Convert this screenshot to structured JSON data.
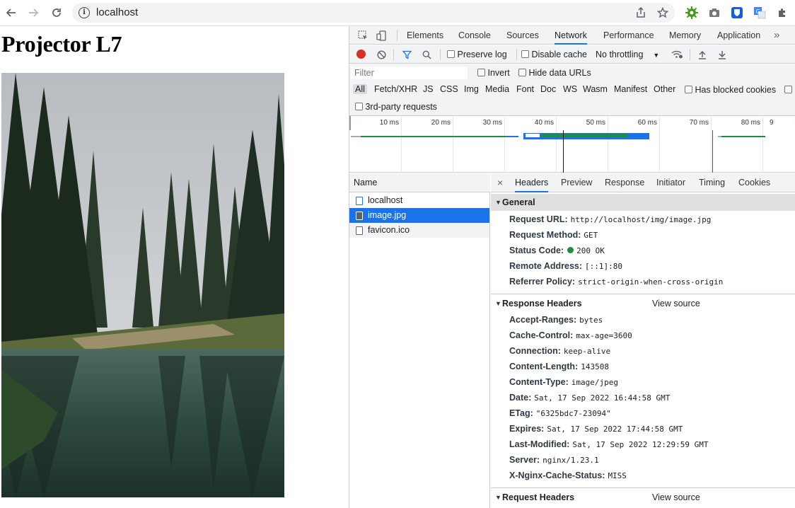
{
  "browser": {
    "url": "localhost"
  },
  "page": {
    "title": "Projector L7"
  },
  "devtools": {
    "tabs": [
      "Elements",
      "Console",
      "Sources",
      "Network",
      "Performance",
      "Memory",
      "Application"
    ],
    "active_tab": "Network",
    "more_tabs": "»",
    "toolbar": {
      "preserve_log": "Preserve log",
      "disable_cache": "Disable cache",
      "throttling": "No throttling"
    },
    "filter": {
      "placeholder": "Filter",
      "invert": "Invert",
      "hide_data_urls": "Hide data URLs"
    },
    "types": [
      "All",
      "Fetch/XHR",
      "JS",
      "CSS",
      "Img",
      "Media",
      "Font",
      "Doc",
      "WS",
      "Wasm",
      "Manifest",
      "Other"
    ],
    "has_blocked_cookies": "Has blocked cookies",
    "third_party": "3rd-party requests",
    "timeline_ticks": [
      "10 ms",
      "20 ms",
      "30 ms",
      "40 ms",
      "50 ms",
      "60 ms",
      "70 ms",
      "80 ms",
      "9"
    ],
    "name_header": "Name",
    "requests": [
      {
        "name": "localhost",
        "type": "doc"
      },
      {
        "name": "image.jpg",
        "type": "img",
        "selected": true
      },
      {
        "name": "favicon.ico",
        "type": "other"
      }
    ],
    "detail_tabs": [
      "Headers",
      "Preview",
      "Response",
      "Initiator",
      "Timing",
      "Cookies"
    ],
    "general": {
      "title": "General",
      "rows": [
        {
          "key": "Request URL:",
          "value": "http://localhost/img/image.jpg"
        },
        {
          "key": "Request Method:",
          "value": "GET"
        },
        {
          "key": "Status Code:",
          "value": "200 OK"
        },
        {
          "key": "Remote Address:",
          "value": "[::1]:80"
        },
        {
          "key": "Referrer Policy:",
          "value": "strict-origin-when-cross-origin"
        }
      ]
    },
    "response_headers": {
      "title": "Response Headers",
      "view_source": "View source",
      "rows": [
        {
          "key": "Accept-Ranges:",
          "value": "bytes"
        },
        {
          "key": "Cache-Control:",
          "value": "max-age=3600"
        },
        {
          "key": "Connection:",
          "value": "keep-alive"
        },
        {
          "key": "Content-Length:",
          "value": "143508"
        },
        {
          "key": "Content-Type:",
          "value": "image/jpeg"
        },
        {
          "key": "Date:",
          "value": "Sat, 17 Sep 2022 16:44:58 GMT"
        },
        {
          "key": "ETag:",
          "value": "\"6325bdc7-23094\""
        },
        {
          "key": "Expires:",
          "value": "Sat, 17 Sep 2022 17:44:58 GMT"
        },
        {
          "key": "Last-Modified:",
          "value": "Sat, 17 Sep 2022 12:29:59 GMT"
        },
        {
          "key": "Server:",
          "value": "nginx/1.23.1"
        },
        {
          "key": "X-Nginx-Cache-Status:",
          "value": "MISS"
        }
      ]
    },
    "request_headers": {
      "title": "Request Headers",
      "view_source": "View source"
    },
    "colors": {
      "accent": "#1a73e8",
      "record": "#d93025",
      "status_ok": "#1e8e3e"
    }
  }
}
